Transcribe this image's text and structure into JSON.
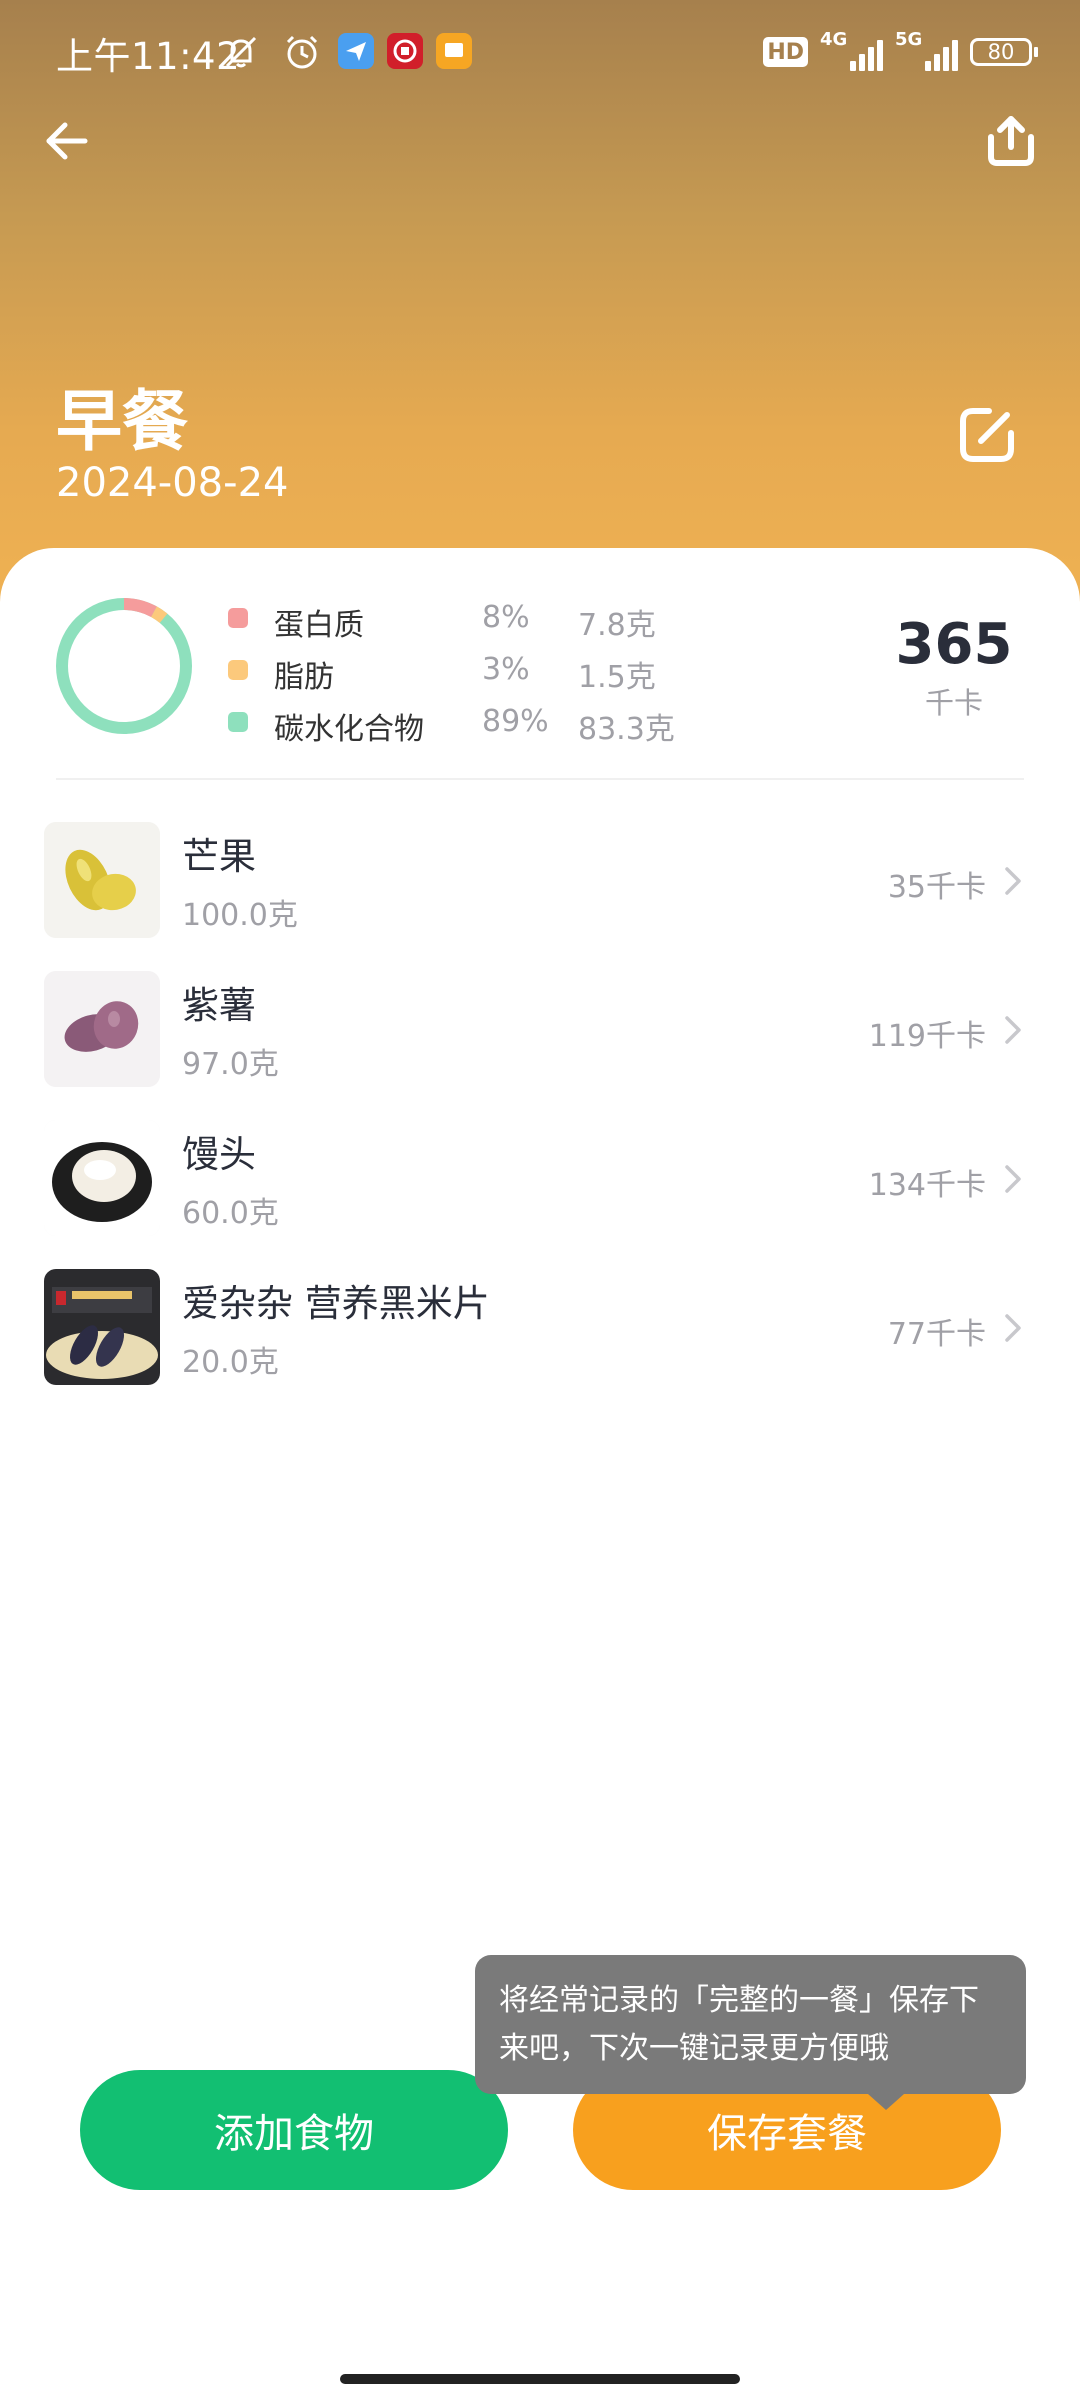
{
  "status_bar": {
    "time": "上午11:42",
    "hd_label": "HD",
    "network_1": "4G",
    "network_2": "5G",
    "battery": "80"
  },
  "header": {
    "meal_title": "早餐",
    "date": "2024-08-24"
  },
  "nutrition": {
    "items": [
      {
        "name": "蛋白质",
        "percent": "8%",
        "amount": "7.8克",
        "color": "#f59c9c"
      },
      {
        "name": "脂肪",
        "percent": "3%",
        "amount": "1.5克",
        "color": "#fcc97c"
      },
      {
        "name": "碳水化合物",
        "percent": "89%",
        "amount": "83.3克",
        "color": "#8ee0bd"
      }
    ],
    "total_value": "365",
    "total_unit": "千卡"
  },
  "foods": [
    {
      "name": "芒果",
      "weight": "100.0克",
      "kcal": "35千卡"
    },
    {
      "name": "紫薯",
      "weight": "97.0克",
      "kcal": "119千卡"
    },
    {
      "name": "馒头",
      "weight": "60.0克",
      "kcal": "134千卡"
    },
    {
      "name": "爱杂杂 营养黑米片",
      "weight": "20.0克",
      "kcal": "77千卡"
    }
  ],
  "tooltip": {
    "line1": "将经常记录的「完整的一餐」保存下",
    "line2": "来吧，下次一键记录更方便哦"
  },
  "buttons": {
    "add_food": "添加食物",
    "save_set": "保存套餐"
  },
  "colors": {
    "add_button": "#12bf72",
    "save_button": "#f8a01e",
    "header_top": "#a6804d",
    "header_bottom": "#f0b253"
  }
}
